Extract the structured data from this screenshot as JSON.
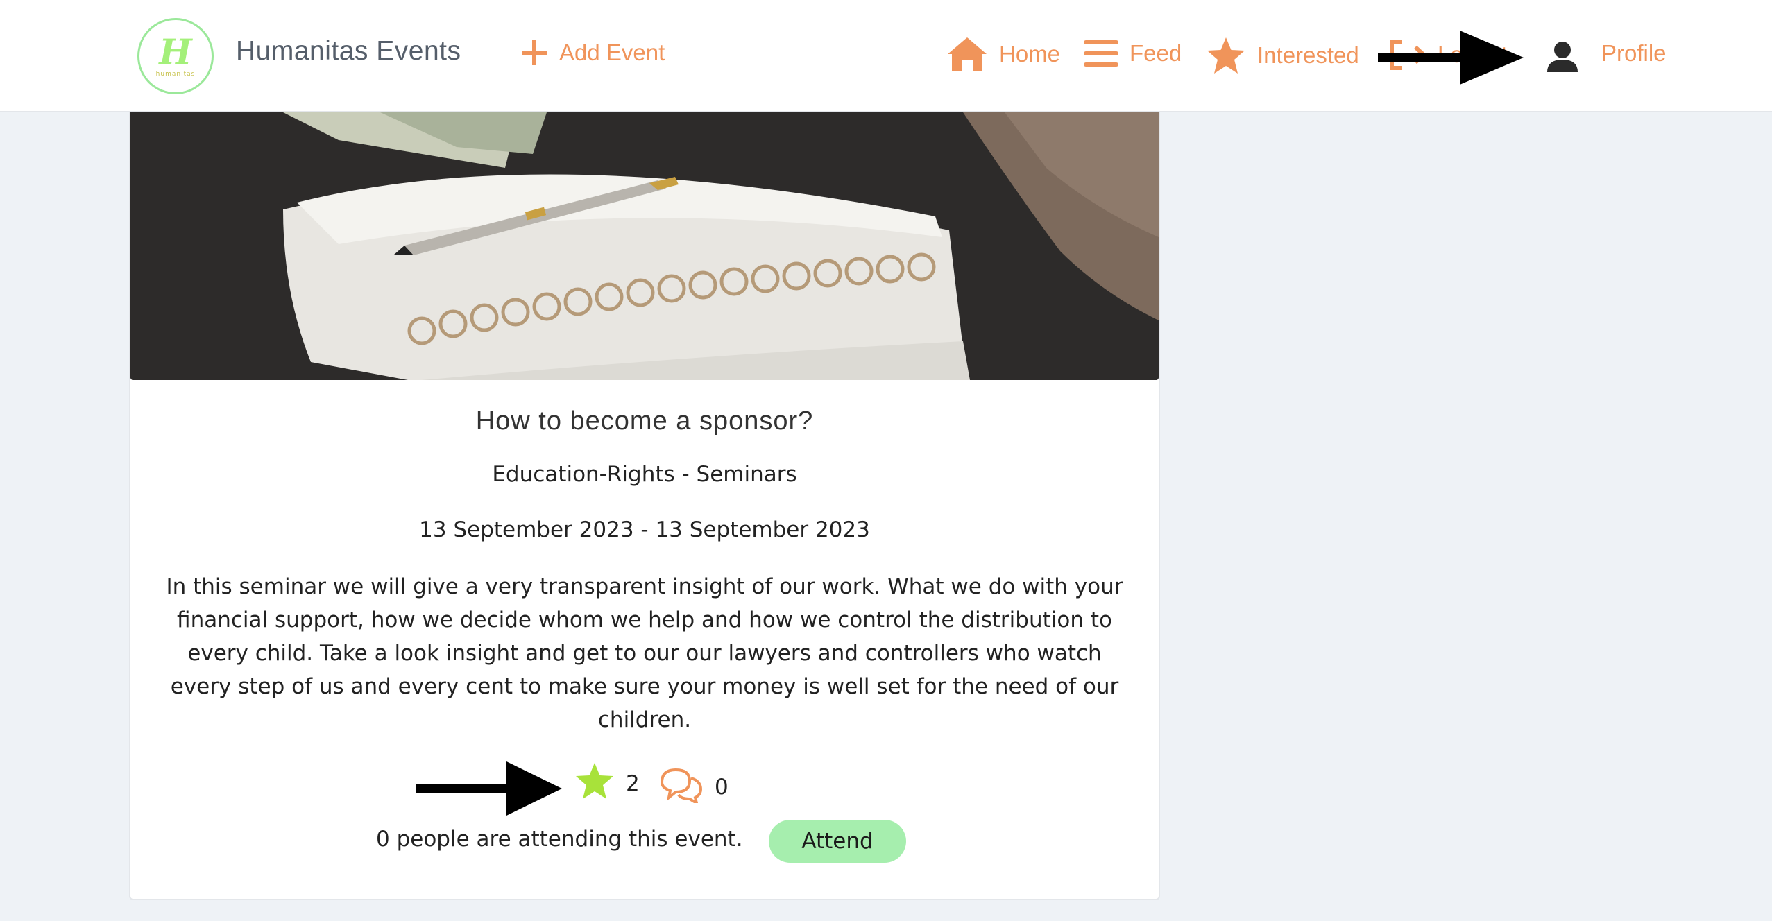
{
  "brand": {
    "name": "Humanitas Events",
    "logo_letter": "H",
    "logo_subtext": "humanitas"
  },
  "nav": {
    "add_event": "Add Event",
    "home": "Home",
    "feed": "Feed",
    "interested": "Interested",
    "logout": "Logout",
    "profile": "Profile"
  },
  "event": {
    "title": "How to become a sponsor?",
    "category": "Education-Rights - Seminars",
    "dates": "13 September 2023 - 13 September 2023",
    "description": "In this seminar we will give a very transparent insight of our work. What we do with your financial support, how we decide whom we help and how we control the distribution to every child. Take a look insight and get to our our lawyers and controllers who watch every step of us and every cent to make sure your money is well set for the need of our children.",
    "interested_count": "2",
    "comment_count": "0",
    "attending_text": "0 people are attending this event.",
    "attend_label": "Attend"
  },
  "colors": {
    "accent": "#f0945a",
    "attend_button": "#a6eeae",
    "star_active": "#a8e23a",
    "logo_green": "#9be89a"
  },
  "icons": {
    "add": "plus-icon",
    "home": "home-icon",
    "feed": "menu-icon",
    "interested": "star-icon",
    "logout": "logout-icon",
    "profile": "user-icon",
    "comments": "comments-icon"
  }
}
